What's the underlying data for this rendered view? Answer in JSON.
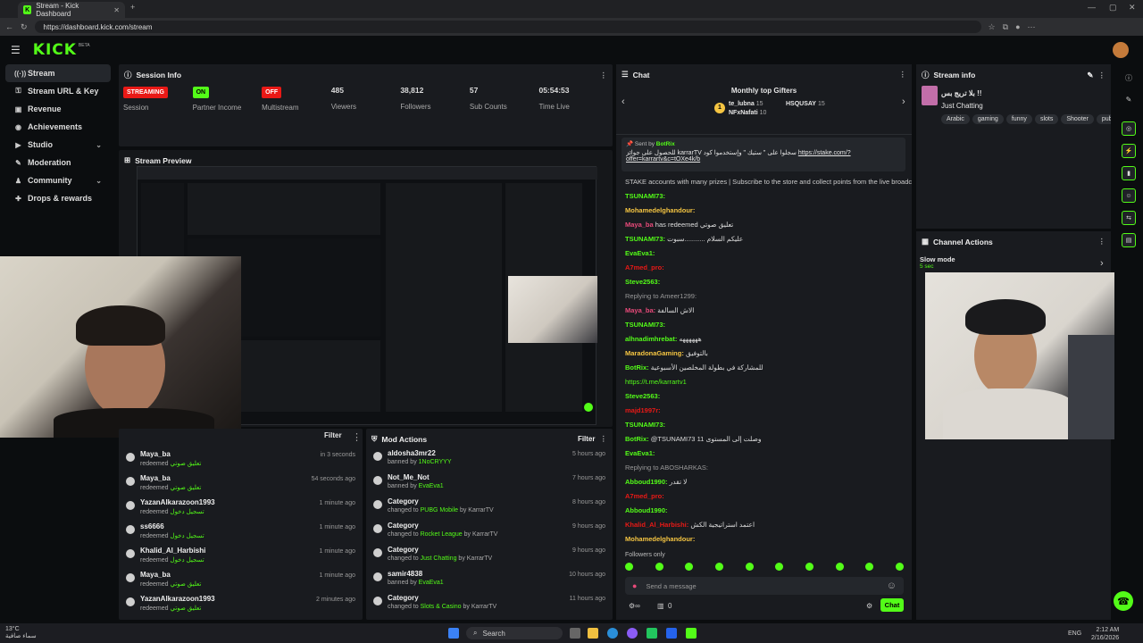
{
  "browser": {
    "tab_title": "Stream - Kick Dashboard",
    "url": "https://dashboard.kick.com/stream",
    "new_tab": "+"
  },
  "header": {
    "logo": "KICK",
    "beta": "BETA"
  },
  "sidebar": {
    "items": [
      {
        "label": "Stream",
        "icon": "broadcast-icon",
        "glyph": "((·))"
      },
      {
        "label": "Stream URL & Key",
        "icon": "key-icon",
        "glyph": "⚿"
      },
      {
        "label": "Revenue",
        "icon": "revenue-icon",
        "glyph": "▣"
      },
      {
        "label": "Achievements",
        "icon": "trophy-icon",
        "glyph": "◉"
      },
      {
        "label": "Studio",
        "icon": "studio-icon",
        "glyph": "▶"
      },
      {
        "label": "Moderation",
        "icon": "sword-icon",
        "glyph": "✎"
      },
      {
        "label": "Community",
        "icon": "community-icon",
        "glyph": "♟"
      },
      {
        "label": "Drops & rewards",
        "icon": "gift-icon",
        "glyph": "✚"
      }
    ]
  },
  "session_info": {
    "title": "Session Info",
    "stats": [
      {
        "badge": "STREAMING",
        "badge_color": "#e91916",
        "label": "Session"
      },
      {
        "badge": "ON",
        "badge_color": "#53fc18",
        "label": "Partner Income"
      },
      {
        "badge": "OFF",
        "badge_color": "#e91916",
        "label": "Multistream"
      },
      {
        "value": "485",
        "label": "Viewers"
      },
      {
        "value": "38,812",
        "label": "Followers"
      },
      {
        "value": "57",
        "label": "Sub Counts"
      },
      {
        "value": "05:54:53",
        "label": "Time Live"
      }
    ]
  },
  "stream_preview": {
    "title": "Stream Preview"
  },
  "redemptions": {
    "filter": "Filter",
    "rows": [
      {
        "name": "Maya_ba",
        "action": "redeemed",
        "item": "تعليق صوتي",
        "time": "in 3 seconds"
      },
      {
        "name": "Maya_ba",
        "action": "redeemed",
        "item": "تعليق صوتي",
        "time": "54 seconds ago"
      },
      {
        "name": "YazanAlkarazoon1993",
        "action": "redeemed",
        "item": "تسجيل دخول",
        "time": "1 minute ago"
      },
      {
        "name": "ss6666",
        "action": "redeemed",
        "item": "تسجيل دخول",
        "time": "1 minute ago"
      },
      {
        "name": "Khalid_Al_Harbishi",
        "action": "redeemed",
        "item": "تسجيل دخول",
        "time": "1 minute ago"
      },
      {
        "name": "Maya_ba",
        "action": "redeemed",
        "item": "تعليق صوتي",
        "time": "1 minute ago"
      },
      {
        "name": "YazanAlkarazoon1993",
        "action": "redeemed",
        "item": "تعليق صوتي",
        "time": "2 minutes ago"
      }
    ]
  },
  "mod_actions": {
    "title": "Mod Actions",
    "filter": "Filter",
    "rows": [
      {
        "name": "aldosha3mr22",
        "pre": "banned by",
        "target": "1NoCRYYY",
        "post": "",
        "time": "5 hours ago"
      },
      {
        "name": "Not_Me_Not",
        "pre": "banned by",
        "target": "EvaEva1",
        "post": "",
        "time": "7 hours ago"
      },
      {
        "name": "Category",
        "pre": "changed to",
        "target": "PUBG Mobile",
        "post": "by KarrarTV",
        "time": "8 hours ago"
      },
      {
        "name": "Category",
        "pre": "changed to",
        "target": "Rocket League",
        "post": "by KarrarTV",
        "time": "9 hours ago"
      },
      {
        "name": "Category",
        "pre": "changed to",
        "target": "Just Chatting",
        "post": "by KarrarTV",
        "time": "9 hours ago"
      },
      {
        "name": "samir4838",
        "pre": "banned by",
        "target": "EvaEva1",
        "post": "",
        "time": "10 hours ago"
      },
      {
        "name": "Category",
        "pre": "changed to",
        "target": "Slots & Casino",
        "post": "by KarrarTV",
        "time": "11 hours ago"
      }
    ]
  },
  "chat": {
    "title": "Chat",
    "gifters_title": "Monthly top Gifters",
    "gifters": [
      {
        "name": "te_lubna",
        "count": "15"
      },
      {
        "name": "HSQUSAY",
        "count": "15"
      },
      {
        "name": "NFxNafati",
        "count": "10"
      }
    ],
    "pinned": {
      "sent_by": "Sent by",
      "user": "BotRix",
      "text": "للحصول على جوائز karrarTV سجلوا على \" ستيك \" وإستخدموا كود",
      "link": "https://stake.com/?",
      "link2": "offer=karrartv&c=tOXe4k/b"
    },
    "messages": [
      {
        "user": "",
        "color": "#cccccc",
        "text": "STAKE accounts with many prizes | Subscribe to the store and collect points from the live broadcast."
      },
      {
        "user": "TSUNAMI73:",
        "color": "#53fc18",
        "text": ""
      },
      {
        "user": "Mohamedelghandour:",
        "color": "#f5c542",
        "text": ""
      },
      {
        "user": "Maya_ba",
        "color": "#e84a7a",
        "text": "has redeemed تعليق صوتي"
      },
      {
        "user": "TSUNAMI73:",
        "color": "#53fc18",
        "text": "عليكم السلام ...........سبوت"
      },
      {
        "user": "EvaEva1:",
        "color": "#53fc18",
        "text": ""
      },
      {
        "user": "A7med_pro:",
        "color": "#e91916",
        "text": ""
      },
      {
        "user": "Steve2563:",
        "color": "#53fc18",
        "text": ""
      },
      {
        "user": "",
        "color": "#999999",
        "text": "Replying to Ameer1299:"
      },
      {
        "user": "Maya_ba:",
        "color": "#e84a7a",
        "text": "الاش السالفة"
      },
      {
        "user": "TSUNAMI73:",
        "color": "#53fc18",
        "text": ""
      },
      {
        "user": "alhnadimhrebat:",
        "color": "#53fc18",
        "text": "ههههههه"
      },
      {
        "user": "MaradonaGaming:",
        "color": "#f5c542",
        "text": "بالتوفيق"
      },
      {
        "user": "BotRix:",
        "color": "#53fc18",
        "text": "للمشاركة في بطولة المخلصين الأسبوعية"
      },
      {
        "user": "",
        "color": "#53fc18",
        "text": "https://t.me/karrartv1"
      },
      {
        "user": "Steve2563:",
        "color": "#53fc18",
        "text": ""
      },
      {
        "user": "majd1997r:",
        "color": "#e91916",
        "text": ""
      },
      {
        "user": "TSUNAMI73:",
        "color": "#53fc18",
        "text": ""
      },
      {
        "user": "BotRix:",
        "color": "#53fc18",
        "text": "@TSUNAMI73 وصلت إلى المستوى 11"
      },
      {
        "user": "EvaEva1:",
        "color": "#53fc18",
        "text": ""
      },
      {
        "user": "",
        "color": "#999999",
        "text": "Replying to ABOSHARKAS:"
      },
      {
        "user": "Abboud1990:",
        "color": "#53fc18",
        "text": "لا تقدر"
      },
      {
        "user": "A7med_pro:",
        "color": "#e91916",
        "text": ""
      },
      {
        "user": "Abboud1990:",
        "color": "#53fc18",
        "text": ""
      },
      {
        "user": "Khalid_Al_Harbishi:",
        "color": "#e91916",
        "text": "اعتمد استراتيجية الكش"
      },
      {
        "user": "Mohamedelghandour:",
        "color": "#f5c542",
        "text": ""
      }
    ],
    "followers_only": "Followers only",
    "placeholder": "Send a message",
    "chat_button": "Chat",
    "counter": "0"
  },
  "stream_info": {
    "title": "Stream info",
    "stream_title": "بلا تريج بس !!",
    "category": "Just Chatting",
    "tags": [
      "Arabic",
      "gaming",
      "funny",
      "slots",
      "Shooter",
      "pub"
    ]
  },
  "channel_actions": {
    "title": "Channel Actions",
    "slow_mode": "Slow mode",
    "slow_value": "5 sec"
  },
  "taskbar": {
    "weather_temp": "13°C",
    "weather_desc": "سماء صافية",
    "search": "Search",
    "lang": "ENG",
    "time": "2:12 AM",
    "date": "2/16/2026"
  }
}
